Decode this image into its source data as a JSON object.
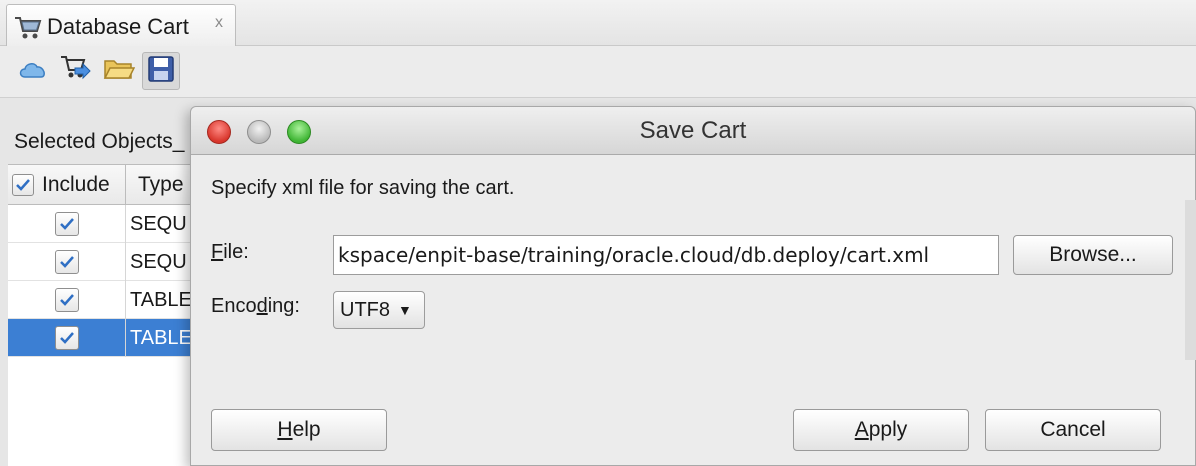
{
  "panel": {
    "tab_title": "Database Cart",
    "tab_close": "x",
    "toolbar": {
      "buttons": [
        {
          "icon": "cloud-icon"
        },
        {
          "icon": "deploy-icon"
        },
        {
          "icon": "open-folder-icon"
        },
        {
          "icon": "save-icon"
        }
      ]
    },
    "selected_objects_label": "Selected Objects_",
    "columns": {
      "include": "Include",
      "type": "Type"
    },
    "rows": [
      {
        "type": "SEQU",
        "checked": true
      },
      {
        "type": "SEQU",
        "checked": true
      },
      {
        "type": "TABLE",
        "checked": true
      },
      {
        "type": "TABLE",
        "checked": true
      }
    ]
  },
  "dialog": {
    "title": "Save Cart",
    "instruction": "Specify xml file for saving the cart.",
    "file_label_mnemonic": "F",
    "file_label_rest": "ile:",
    "file_value": "kspace/enpit-base/training/oracle.cloud/db.deploy/cart.xml",
    "browse_label": "Browse...",
    "encoding_label_pre": "Enco",
    "encoding_label_mnemonic": "d",
    "encoding_label_post": "ing:",
    "encoding_value": "UTF8",
    "help_mnemonic": "H",
    "help_rest": "elp",
    "apply_mnemonic": "A",
    "apply_rest": "pply",
    "cancel_label": "Cancel"
  },
  "colors": {
    "selection": "#3c7fd3",
    "close_light": "#d8362c",
    "maximize_light": "#3fb534"
  }
}
